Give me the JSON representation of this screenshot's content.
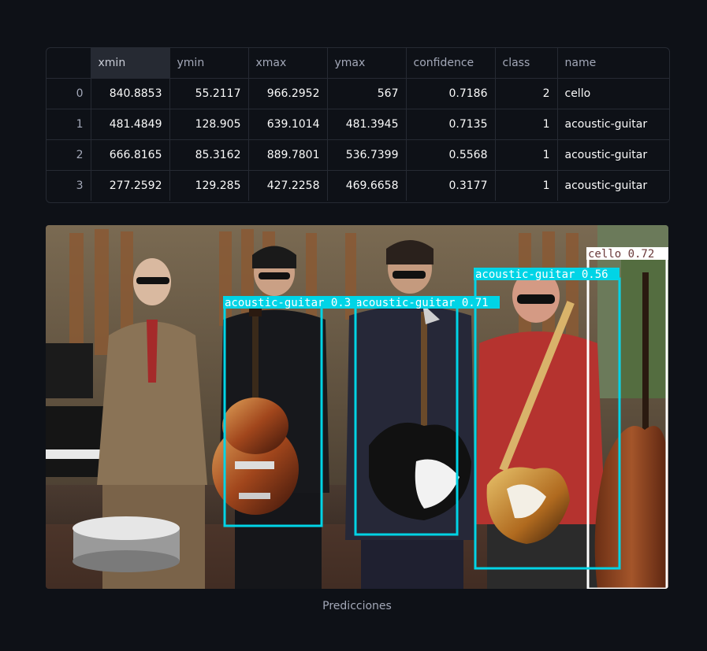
{
  "table": {
    "columns": [
      "",
      "xmin",
      "ymin",
      "xmax",
      "ymax",
      "confidence",
      "class",
      "name"
    ],
    "rows": [
      {
        "idx": "0",
        "xmin": "840.8853",
        "ymin": "55.2117",
        "xmax": "966.2952",
        "ymax": "567",
        "confidence": "0.7186",
        "class": "2",
        "name": "cello"
      },
      {
        "idx": "1",
        "xmin": "481.4849",
        "ymin": "128.905",
        "xmax": "639.1014",
        "ymax": "481.3945",
        "confidence": "0.7135",
        "class": "1",
        "name": "acoustic-guitar"
      },
      {
        "idx": "2",
        "xmin": "666.8165",
        "ymin": "85.3162",
        "xmax": "889.7801",
        "ymax": "536.7399",
        "confidence": "0.5568",
        "class": "1",
        "name": "acoustic-guitar"
      },
      {
        "idx": "3",
        "xmin": "277.2592",
        "ymin": "129.285",
        "xmax": "427.2258",
        "ymax": "469.6658",
        "confidence": "0.3177",
        "class": "1",
        "name": "acoustic-guitar"
      }
    ]
  },
  "image": {
    "detections": [
      {
        "label": "cello 0.72"
      },
      {
        "label": "acoustic-guitar 0.56"
      },
      {
        "label": "acoustic-guitar 0.71"
      },
      {
        "label": "acoustic-guitar 0.3"
      }
    ],
    "box_colors": {
      "cello": "#ffffff",
      "acoustic-guitar": "#00d4e6"
    }
  },
  "caption": "Predicciones"
}
